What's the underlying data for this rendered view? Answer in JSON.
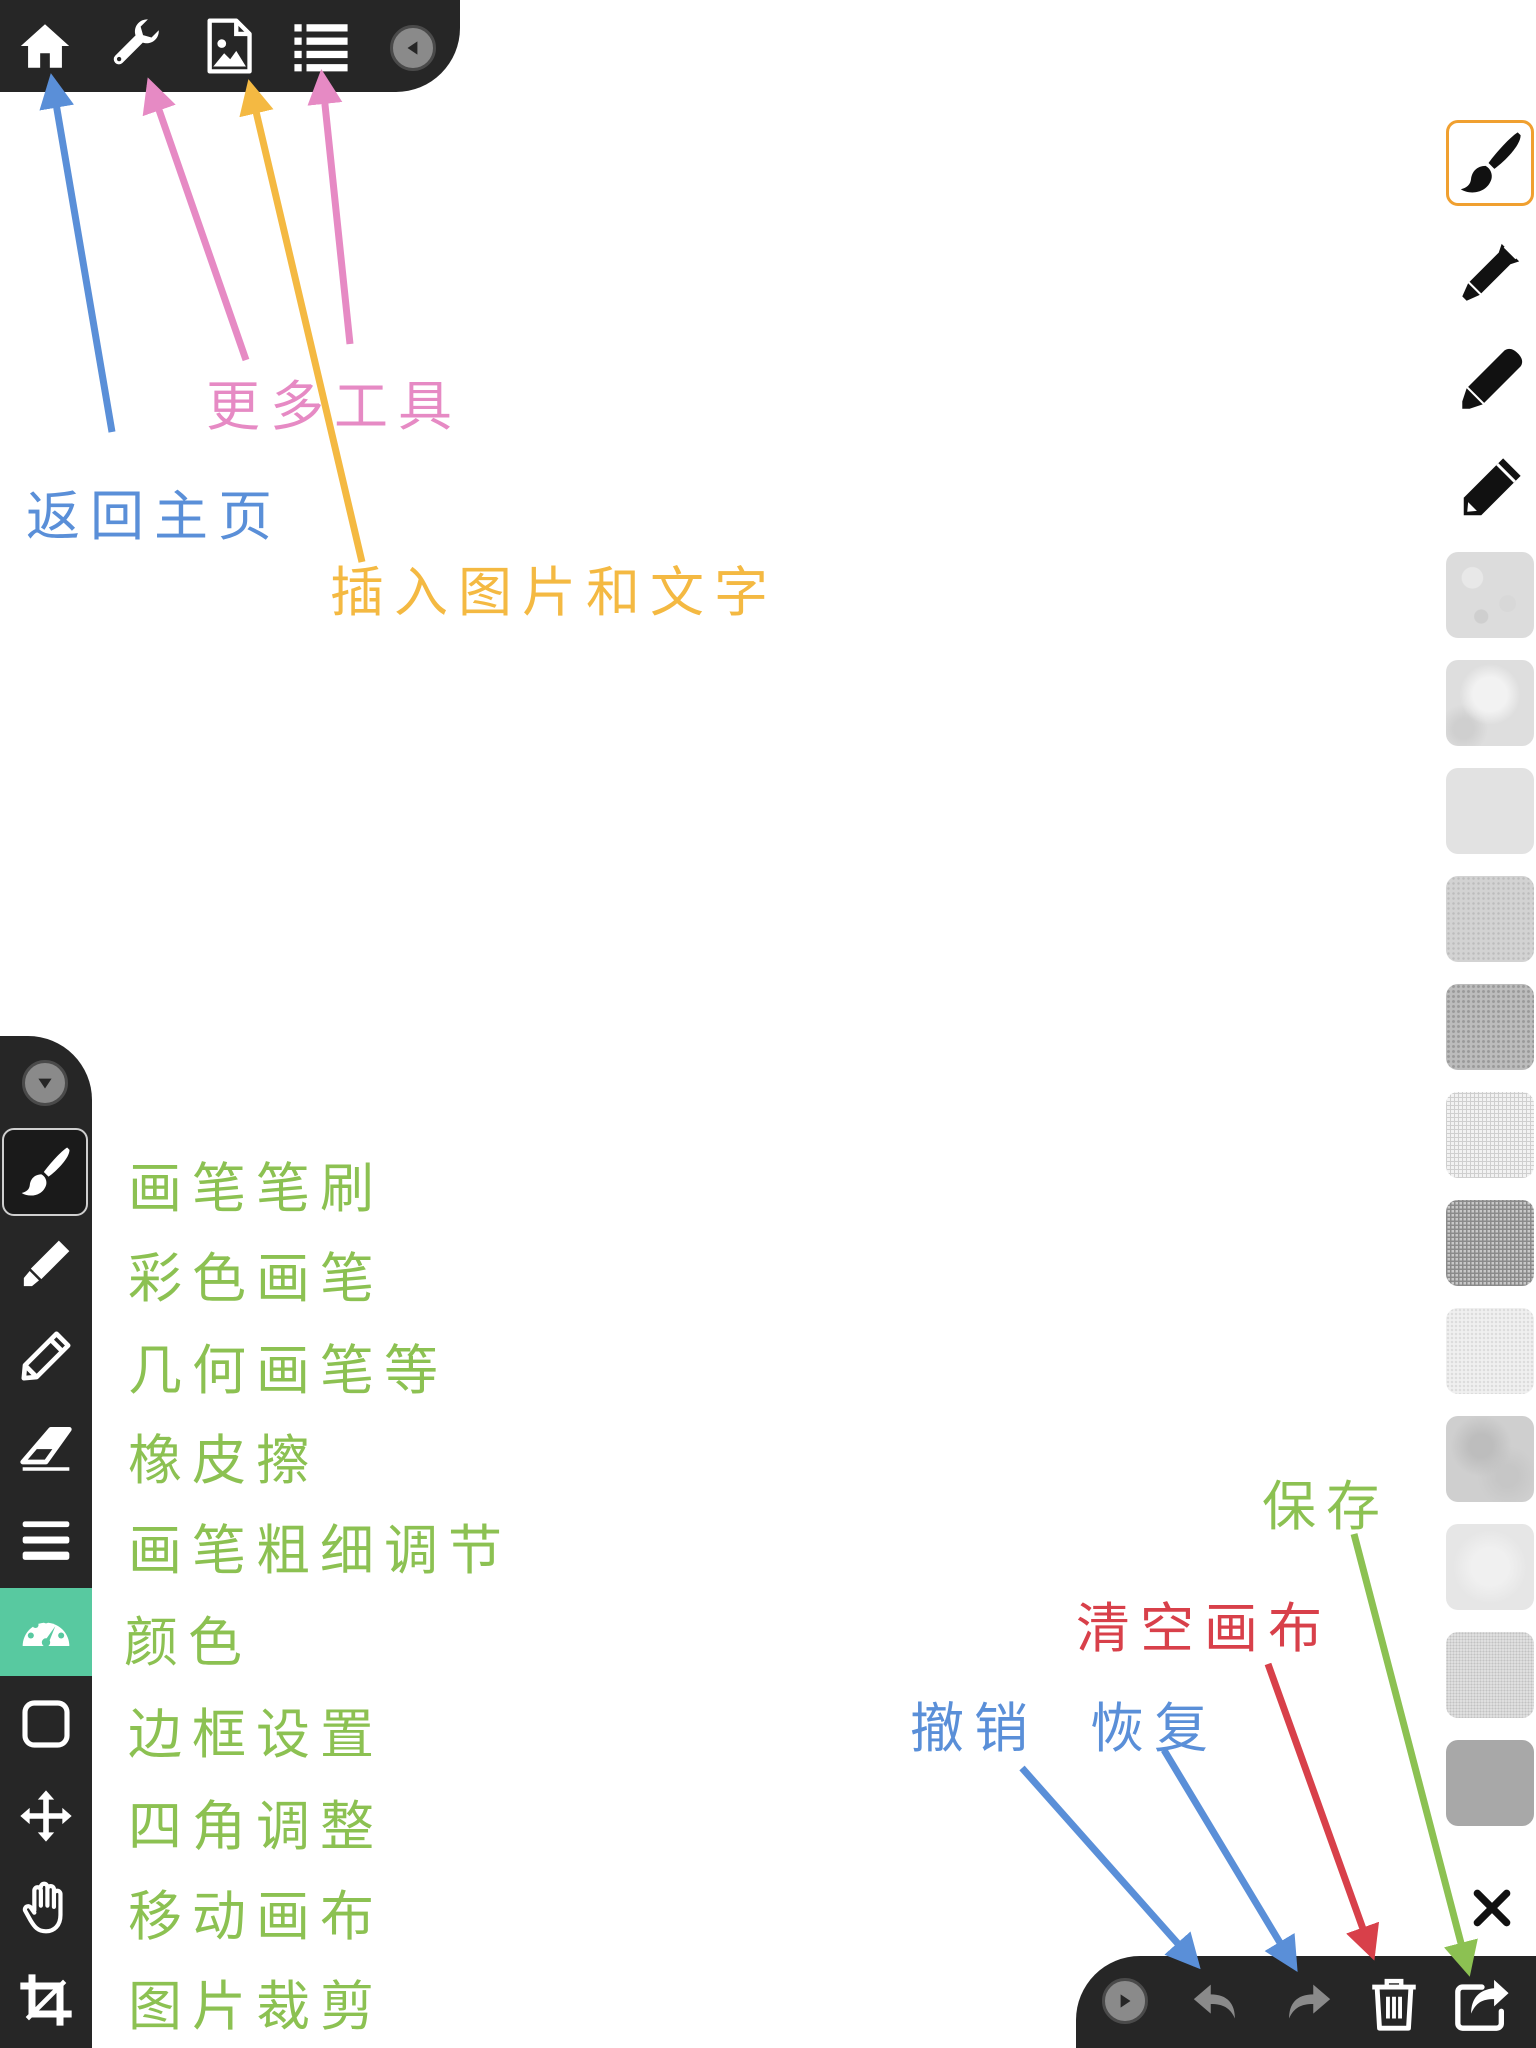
{
  "top_toolbar": {
    "buttons": [
      {
        "icon": "home-icon"
      },
      {
        "icon": "wrench-icon"
      },
      {
        "icon": "insert-image-icon"
      },
      {
        "icon": "list-icon"
      }
    ],
    "collapse_icon": "triangle-left-icon"
  },
  "left_toolbar": {
    "collapse_icon": "triangle-down-icon",
    "tools": [
      {
        "icon": "paintbrush-icon",
        "active": true
      },
      {
        "icon": "marker-icon"
      },
      {
        "icon": "pencil-icon"
      },
      {
        "icon": "eraser-icon"
      },
      {
        "icon": "brush-size-icon"
      },
      {
        "icon": "color-gauge-icon",
        "highlight": "#58c9a0"
      },
      {
        "icon": "border-square-icon"
      },
      {
        "icon": "move-arrows-icon"
      },
      {
        "icon": "hand-icon"
      },
      {
        "icon": "crop-icon"
      }
    ]
  },
  "right_palette": {
    "brushes": [
      {
        "icon": "paintbrush-icon",
        "selected": true,
        "accent": "#f0a030"
      },
      {
        "icon": "calligraphy-pen-icon"
      },
      {
        "icon": "marker-pen-icon"
      },
      {
        "icon": "pencil-icon"
      }
    ],
    "textures": [
      "speckled-texture",
      "cloudy-texture",
      "smooth-gray-texture",
      "grain-texture",
      "dark-grain-texture",
      "fine-mesh-texture",
      "dark-mesh-texture",
      "light-dots-texture",
      "watercolor-texture",
      "faint-texture",
      "noise-texture",
      "solid-gray-texture"
    ],
    "close_icon": "close-icon"
  },
  "bottom_toolbar": {
    "expand_icon": "triangle-right-icon",
    "buttons": [
      {
        "icon": "undo-icon"
      },
      {
        "icon": "redo-icon"
      },
      {
        "icon": "trash-icon"
      },
      {
        "icon": "share-icon"
      }
    ]
  },
  "annotations": {
    "home": "返回主页",
    "more_tools": "更多工具",
    "insert": "插入图片和文字",
    "tool_labels": [
      "画笔笔刷",
      "彩色画笔",
      "几何画笔等",
      "橡皮擦",
      "画笔粗细调节",
      "颜色",
      "边框设置",
      "四角调整",
      "移动画布",
      "图片裁剪"
    ],
    "undo": "撤销",
    "redo": "恢复",
    "clear": "清空画布",
    "save": "保存"
  },
  "colors": {
    "toolbar_bg": "#262626",
    "green": "#8cc152",
    "blue": "#5a8fd8",
    "pink": "#e68ac4",
    "orange": "#f4b942",
    "red": "#d8404a",
    "selected_border": "#f0a030",
    "color_tool_highlight": "#58c9a0"
  }
}
